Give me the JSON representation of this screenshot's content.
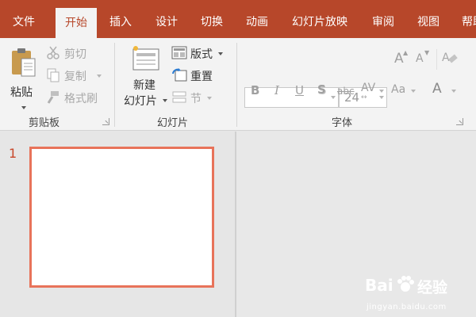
{
  "tabs": [
    {
      "label": "文件",
      "active": false
    },
    {
      "label": "开始",
      "active": true
    },
    {
      "label": "插入",
      "active": false
    },
    {
      "label": "设计",
      "active": false
    },
    {
      "label": "切换",
      "active": false
    },
    {
      "label": "动画",
      "active": false
    },
    {
      "label": "幻灯片放映",
      "active": false
    },
    {
      "label": "审阅",
      "active": false
    },
    {
      "label": "视图",
      "active": false
    },
    {
      "label": "帮助",
      "active": false
    }
  ],
  "clipboard": {
    "paste": "粘贴",
    "cut": "剪切",
    "copy": "复制",
    "format_painter": "格式刷",
    "group_label": "剪贴板"
  },
  "slides": {
    "new_slide_line1": "新建",
    "new_slide_line2": "幻灯片",
    "layout": "版式",
    "reset": "重置",
    "section": "节",
    "group_label": "幻灯片"
  },
  "font": {
    "font_name": "",
    "font_size": "24",
    "group_label": "字体",
    "bold": "B",
    "italic": "I",
    "underline": "U",
    "shadow": "S",
    "strikethrough": "abc",
    "spacing": "AV",
    "change_case": "Aa",
    "font_color": "A",
    "grow": "A",
    "shrink": "A"
  },
  "thumbnails": {
    "slide_number": "1"
  },
  "watermark": {
    "brand": "Bai",
    "brand2": "经验",
    "url": "jingyan.baidu.com"
  },
  "colors": {
    "accent": "#b7472a",
    "thumb_border": "#e8735a"
  }
}
